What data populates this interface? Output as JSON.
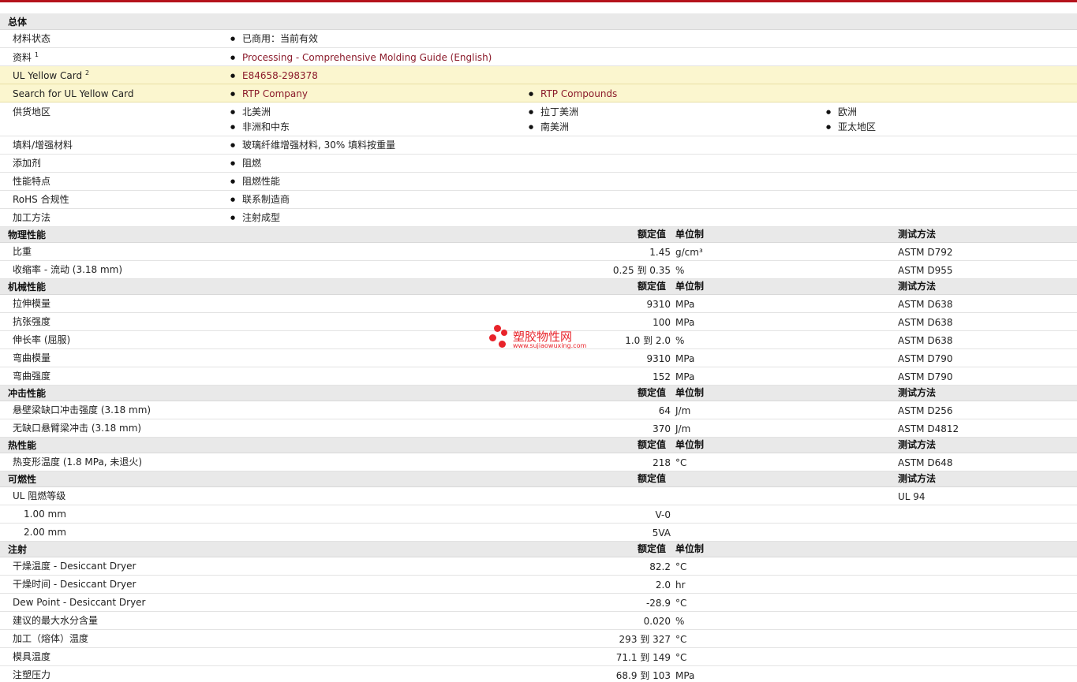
{
  "general": {
    "title": "总体",
    "material_status": {
      "label": "材料状态",
      "value": "已商用：当前有效"
    },
    "docs": {
      "label": "资料",
      "sup": "1",
      "value": "Processing - Comprehensive Molding Guide (English)"
    },
    "ul_card": {
      "label": "UL Yellow Card",
      "sup": "2",
      "value": "E84658-298378"
    },
    "ul_search": {
      "label": "Search for UL Yellow Card",
      "v1": "RTP Company",
      "v2": "RTP Compounds"
    },
    "region": {
      "label": "供货地区",
      "items": [
        "北美洲",
        "拉丁美洲",
        "欧洲",
        "非洲和中东",
        "南美洲",
        "亚太地区"
      ]
    },
    "filler": {
      "label": "填料/增强材料",
      "value": "玻璃纤维增强材料, 30% 填料按重量"
    },
    "additive": {
      "label": "添加剂",
      "value": "阻燃"
    },
    "features": {
      "label": "性能特点",
      "value": "阻燃性能"
    },
    "rohs": {
      "label": "RoHS 合规性",
      "value": "联系制造商"
    },
    "process": {
      "label": "加工方法",
      "value": "注射成型"
    }
  },
  "headers": {
    "rated": "额定值",
    "unit": "单位制",
    "test": "测试方法"
  },
  "physical": {
    "title": "物理性能",
    "rows": [
      {
        "label": "比重",
        "value": "1.45",
        "unit": "g/cm³",
        "test": "ASTM D792"
      },
      {
        "label": "收缩率  - 流动  (3.18 mm)",
        "value": "0.25 到  0.35",
        "unit": "%",
        "test": "ASTM D955"
      }
    ]
  },
  "mechanical": {
    "title": "机械性能",
    "rows": [
      {
        "label": "拉伸模量",
        "value": "9310",
        "unit": "MPa",
        "test": "ASTM D638"
      },
      {
        "label": "抗张强度",
        "value": "100",
        "unit": "MPa",
        "test": "ASTM D638"
      },
      {
        "label": "伸长率  (屈服)",
        "value": "1.0 到  2.0",
        "unit": "%",
        "test": "ASTM D638"
      },
      {
        "label": "弯曲模量",
        "value": "9310",
        "unit": "MPa",
        "test": "ASTM D790"
      },
      {
        "label": "弯曲强度",
        "value": "152",
        "unit": "MPa",
        "test": "ASTM D790"
      }
    ]
  },
  "impact": {
    "title": "冲击性能",
    "rows": [
      {
        "label": "悬壁梁缺口冲击强度  (3.18 mm)",
        "value": "64",
        "unit": "J/m",
        "test": "ASTM D256"
      },
      {
        "label": "无缺口悬臂梁冲击  (3.18 mm)",
        "value": "370",
        "unit": "J/m",
        "test": "ASTM D4812"
      }
    ]
  },
  "thermal": {
    "title": "热性能",
    "rows": [
      {
        "label": "热变形温度  (1.8 MPa, 未退火)",
        "value": "218",
        "unit": "°C",
        "test": "ASTM D648"
      }
    ]
  },
  "flammability": {
    "title": "可燃性",
    "rows": [
      {
        "label": "UL 阻燃等级",
        "value": "",
        "unit": "",
        "test": "UL 94"
      },
      {
        "label": "1.00 mm",
        "value": "V-0",
        "unit": "",
        "test": ""
      },
      {
        "label": "2.00 mm",
        "value": "5VA",
        "unit": "",
        "test": ""
      }
    ]
  },
  "injection": {
    "title": "注射",
    "rows": [
      {
        "label": "干燥温度  - Desiccant Dryer",
        "value": "82.2",
        "unit": "°C"
      },
      {
        "label": "干燥时间  - Desiccant Dryer",
        "value": "2.0",
        "unit": "hr"
      },
      {
        "label": "Dew Point - Desiccant Dryer",
        "value": "-28.9",
        "unit": "°C"
      },
      {
        "label": "建议的最大水分含量",
        "value": "0.020",
        "unit": "%"
      },
      {
        "label": "加工（熔体）温度",
        "value": "293 到  327",
        "unit": "°C"
      },
      {
        "label": "模具温度",
        "value": "71.1 到  149",
        "unit": "°C"
      },
      {
        "label": "注塑压力",
        "value": "68.9 到  103",
        "unit": "MPa"
      }
    ]
  },
  "watermark": {
    "name": "塑胶物性网",
    "url": "www.sujiaowuxing.com",
    "color": "#e8232a"
  }
}
